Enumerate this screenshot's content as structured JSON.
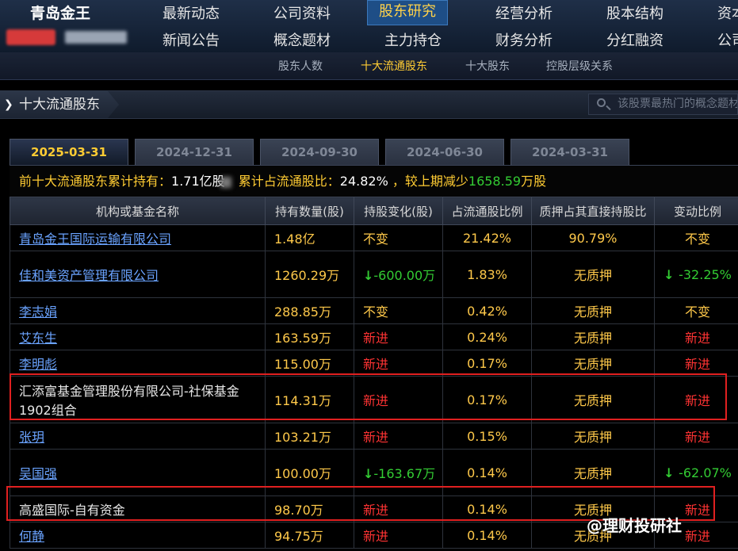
{
  "header": {
    "stock_name": "青岛金王",
    "nav_row1": [
      "最新动态",
      "公司资料",
      "股东研究",
      "经营分析",
      "股本结构",
      "资本"
    ],
    "nav_row2": [
      "新闻公告",
      "概念题材",
      "主力持仓",
      "财务分析",
      "分红融资",
      "公司"
    ],
    "active_nav": "股东研究"
  },
  "subnav": [
    "股东人数",
    "十大流通股东",
    "十大股东",
    "控股层级关系"
  ],
  "subnav_active": "十大流通股东",
  "section": {
    "title": "十大流通股东",
    "search_placeholder": "该股票最热门的概念题材"
  },
  "tabs": [
    "2025-03-31",
    "2024-12-31",
    "2024-09-30",
    "2024-06-30",
    "2024-03-31"
  ],
  "active_tab": "2025-03-31",
  "summary": {
    "label1": "前十大流通股东累计持有：",
    "value1": "1.71亿股",
    "label2": "累计占流通股比：",
    "value2": "24.82%",
    "label3": "，较上期减少",
    "value3": "1658.59",
    "label4": "万股"
  },
  "table": {
    "headers": [
      "机构或基金名称",
      "持有数量(股)",
      "持股变化(股)",
      "占流通股比例",
      "质押占其直接持股比",
      "变动比例"
    ],
    "rows": [
      {
        "name": "青岛金王国际运输有限公司",
        "link": true,
        "qty": "1.48亿",
        "change": "不变",
        "change_type": "same",
        "ratio": "21.42%",
        "pledge": "90.79%",
        "delta": "不变",
        "delta_type": "same"
      },
      {
        "name": "佳和美资产管理有限公司",
        "link": true,
        "qty": "1260.29万",
        "change": "-600.00万",
        "change_type": "down",
        "ratio": "1.83%",
        "pledge": "无质押",
        "delta": "-32.25%",
        "delta_type": "down"
      },
      {
        "name": "李志娟",
        "link": true,
        "qty": "288.85万",
        "change": "不变",
        "change_type": "same",
        "ratio": "0.42%",
        "pledge": "无质押",
        "delta": "不变",
        "delta_type": "same"
      },
      {
        "name": "艾东生",
        "link": true,
        "qty": "163.59万",
        "change": "新进",
        "change_type": "new",
        "ratio": "0.24%",
        "pledge": "无质押",
        "delta": "新进",
        "delta_type": "new"
      },
      {
        "name": "李明彪",
        "link": true,
        "qty": "115.00万",
        "change": "新进",
        "change_type": "new",
        "ratio": "0.17%",
        "pledge": "无质押",
        "delta": "新进",
        "delta_type": "new"
      },
      {
        "name": "汇添富基金管理股份有限公司-社保基金1902组合",
        "link": false,
        "qty": "114.31万",
        "change": "新进",
        "change_type": "new",
        "ratio": "0.17%",
        "pledge": "无质押",
        "delta": "新进",
        "delta_type": "new"
      },
      {
        "name": "张玥",
        "link": true,
        "qty": "103.21万",
        "change": "新进",
        "change_type": "new",
        "ratio": "0.15%",
        "pledge": "无质押",
        "delta": "新进",
        "delta_type": "new"
      },
      {
        "name": "吴国强",
        "link": true,
        "qty": "100.00万",
        "change": "-163.67万",
        "change_type": "down",
        "ratio": "0.14%",
        "pledge": "无质押",
        "delta": "-62.07%",
        "delta_type": "down"
      },
      {
        "name": "高盛国际-自有资金",
        "link": false,
        "qty": "98.70万",
        "change": "新进",
        "change_type": "new",
        "ratio": "0.14%",
        "pledge": "无质押",
        "delta": "新进",
        "delta_type": "new"
      },
      {
        "name": "何静",
        "link": true,
        "qty": "94.75万",
        "change": "新进",
        "change_type": "new",
        "ratio": "0.14%",
        "pledge": "无质押",
        "delta": "新进",
        "delta_type": "new"
      }
    ]
  },
  "watermark": "@理财投研社",
  "colors": {
    "gold": "#ffcc33",
    "link": "#6aa3ff",
    "red": "#ff3333",
    "green": "#33cc33",
    "highlight": "#e02020"
  }
}
